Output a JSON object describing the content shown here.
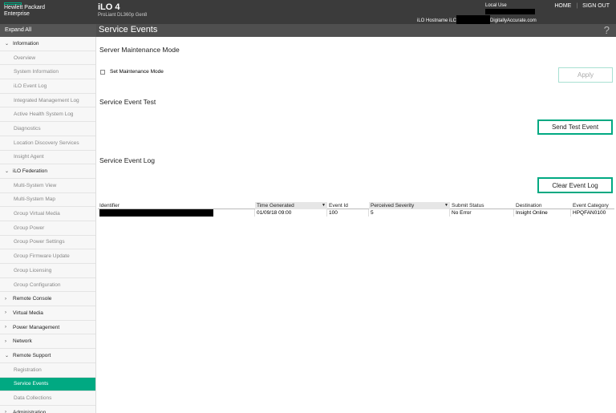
{
  "header": {
    "brand_line1": "Hewlett Packard",
    "brand_line2": "Enterprise",
    "product_title": "iLO 4",
    "product_subtitle": "ProLiant DL360p Gen8",
    "local_user_label": "Local Use",
    "hostname_label": "iLO Hostname  iLC",
    "hostname_suffix": "DigitallyAccurate.com",
    "home": "HOME",
    "separator": "|",
    "sign_out": "SIGN OUT"
  },
  "subbar": {
    "expand_all": "Expand All",
    "page_title": "Service Events",
    "help": "?"
  },
  "sidebar": {
    "items": [
      {
        "label": "Information",
        "type": "group",
        "chev": "⌄"
      },
      {
        "label": "Overview",
        "type": "item"
      },
      {
        "label": "System Information",
        "type": "item"
      },
      {
        "label": "iLO Event Log",
        "type": "item"
      },
      {
        "label": "Integrated Management Log",
        "type": "item"
      },
      {
        "label": "Active Health System Log",
        "type": "item"
      },
      {
        "label": "Diagnostics",
        "type": "item"
      },
      {
        "label": "Location Discovery Services",
        "type": "item"
      },
      {
        "label": "Insight Agent",
        "type": "item"
      },
      {
        "label": "iLO Federation",
        "type": "group",
        "chev": "⌄"
      },
      {
        "label": "Multi-System View",
        "type": "item"
      },
      {
        "label": "Multi-System Map",
        "type": "item"
      },
      {
        "label": "Group Virtual Media",
        "type": "item"
      },
      {
        "label": "Group Power",
        "type": "item"
      },
      {
        "label": "Group Power Settings",
        "type": "item"
      },
      {
        "label": "Group Firmware Update",
        "type": "item"
      },
      {
        "label": "Group Licensing",
        "type": "item"
      },
      {
        "label": "Group Configuration",
        "type": "item"
      },
      {
        "label": "Remote Console",
        "type": "group",
        "chev": "›"
      },
      {
        "label": "Virtual Media",
        "type": "group",
        "chev": "›"
      },
      {
        "label": "Power Management",
        "type": "group",
        "chev": "›"
      },
      {
        "label": "Network",
        "type": "group",
        "chev": "›"
      },
      {
        "label": "Remote Support",
        "type": "group",
        "chev": "⌄"
      },
      {
        "label": "Registration",
        "type": "item"
      },
      {
        "label": "Service Events",
        "type": "item",
        "active": true
      },
      {
        "label": "Data Collections",
        "type": "item"
      },
      {
        "label": "Administration",
        "type": "group",
        "chev": "›"
      }
    ]
  },
  "main": {
    "maintenance_title": "Server Maintenance Mode",
    "maintenance_checkbox_label": "Set Maintenance Mode",
    "apply_label": "Apply",
    "test_title": "Service Event Test",
    "send_test_label": "Send Test Event",
    "log_title": "Service Event Log",
    "clear_log_label": "Clear Event Log"
  },
  "table": {
    "columns": [
      "Identifier",
      "Time Generated",
      "Event Id",
      "Perceived Severity",
      "Submit Status",
      "Destination",
      "Event Category"
    ],
    "sort_arrow": "▼",
    "rows": [
      {
        "time": "01/09/18 09:00",
        "event_id": "100",
        "severity": "5",
        "status": "No Error",
        "destination": "Insight Online",
        "category": "HPQFAN0100"
      }
    ]
  },
  "colors": {
    "accent": "#01a982",
    "topbar": "#3b3b3b"
  }
}
